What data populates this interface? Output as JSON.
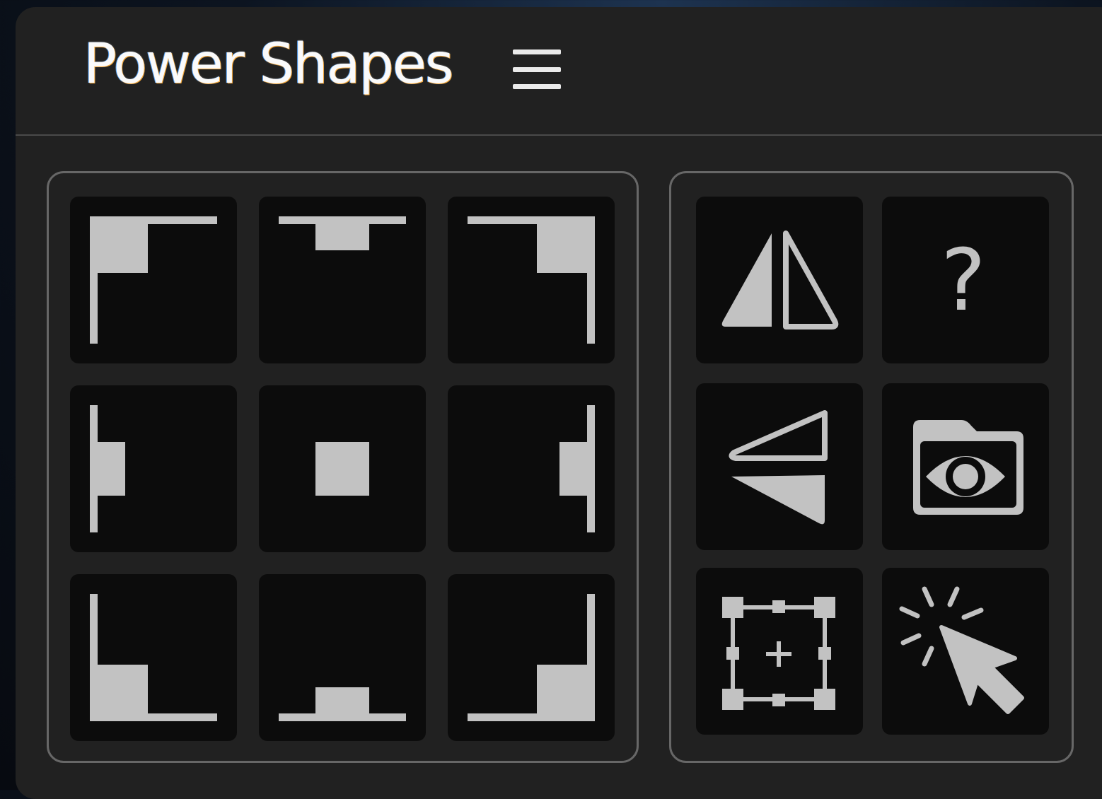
{
  "app": {
    "title": "Power Shapes"
  },
  "header": {
    "menu_icon": "hamburger-menu-icon"
  },
  "alignment_grid": {
    "icons": [
      "align-top-left-icon",
      "align-top-center-icon",
      "align-top-right-icon",
      "align-middle-left-icon",
      "align-center-icon",
      "align-middle-right-icon",
      "align-bottom-left-icon",
      "align-bottom-center-icon",
      "align-bottom-right-icon"
    ]
  },
  "tools": {
    "icons": [
      "flip-horizontal-icon",
      "help-icon",
      "flip-vertical-icon",
      "folder-preview-icon",
      "bounding-box-add-icon",
      "cursor-click-icon"
    ],
    "help_glyph": "?"
  },
  "colors": {
    "panel_bg": "#212121",
    "button_bg": "#0c0c0c",
    "icon_fill": "#c2c2c2",
    "group_border": "#676767"
  }
}
